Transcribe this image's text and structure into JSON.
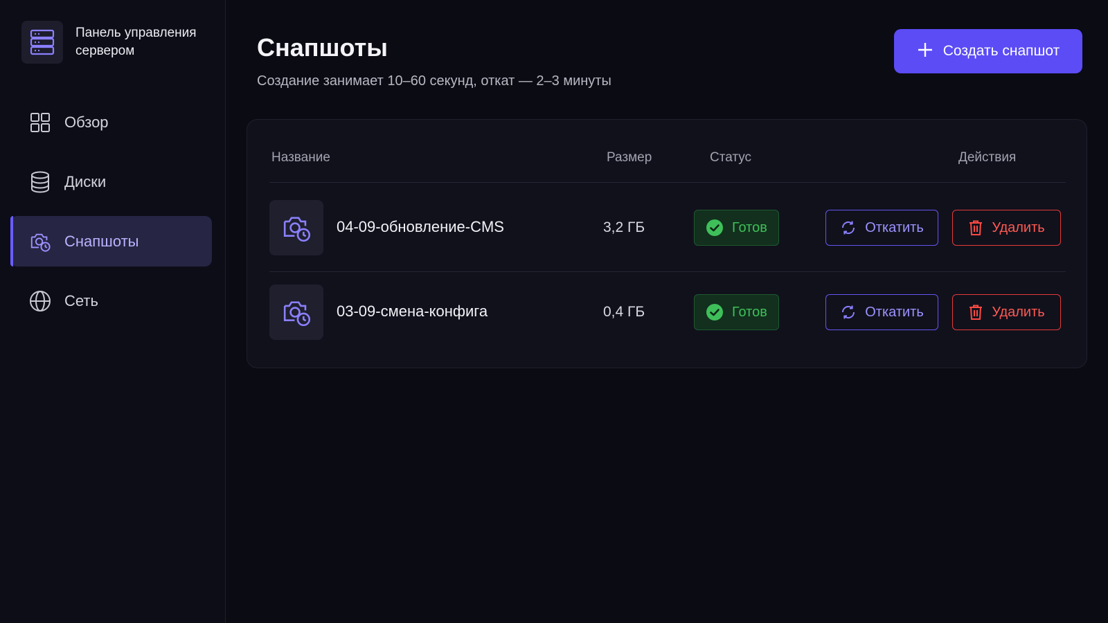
{
  "app": {
    "title": "Панель управления сервером",
    "accent": "#5b4cf5"
  },
  "sidebar": {
    "items": [
      {
        "label": "Обзор",
        "icon": "grid-icon",
        "active": false
      },
      {
        "label": "Диски",
        "icon": "database-icon",
        "active": false
      },
      {
        "label": "Снапшоты",
        "icon": "camera-clock-icon",
        "active": true
      },
      {
        "label": "Сеть",
        "icon": "globe-icon",
        "active": false
      }
    ]
  },
  "header": {
    "title": "Снапшоты",
    "subtitle": "Создание занимает 10–60 секунд, откат — 2–3 минуты",
    "create_label": "Создать снапшот"
  },
  "table": {
    "columns": {
      "name": "Название",
      "size": "Размер",
      "status": "Статус",
      "actions": "Действия"
    },
    "rows": [
      {
        "name": "04-09-обновление-CMS",
        "size": "3,2 ГБ",
        "status": "Готов",
        "rollback_label": "Откатить",
        "delete_label": "Удалить"
      },
      {
        "name": "03-09-смена-конфига",
        "size": "0,4 ГБ",
        "status": "Готов",
        "rollback_label": "Откатить",
        "delete_label": "Удалить"
      }
    ]
  },
  "colors": {
    "status_ok": "#3fbf5a",
    "danger": "#e53a3a",
    "active_nav": "#262543"
  }
}
